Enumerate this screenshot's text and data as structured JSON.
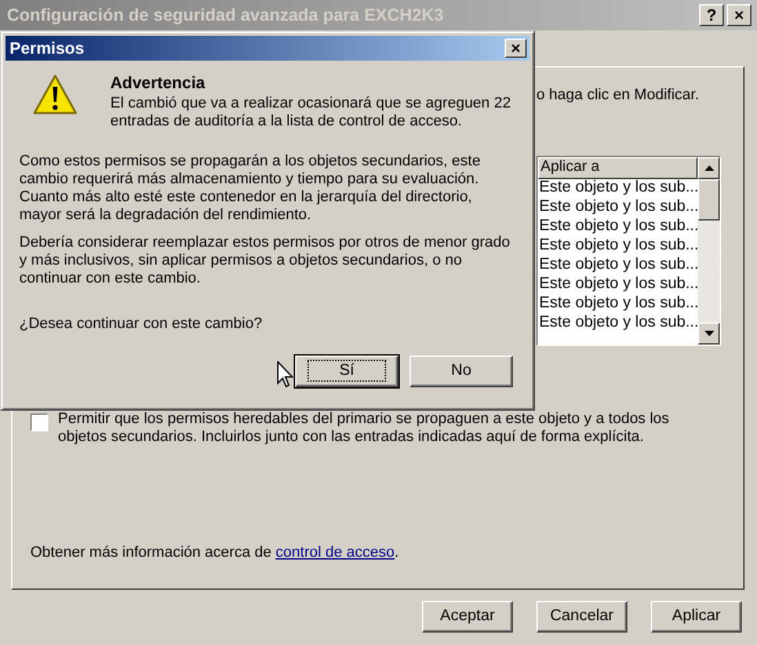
{
  "window": {
    "title": "Configuración de seguridad avanzada para EXCH2K3",
    "title_buttons": [
      "?",
      "×"
    ]
  },
  "instruction": "o haga clic en Modificar.",
  "entries_list": {
    "columns": [
      "Aplicar a"
    ],
    "rows": [
      "Este objeto y los sub...",
      "Este objeto y los sub...",
      "Este objeto y los sub...",
      "Este objeto y los sub...",
      "Este objeto y los sub...",
      "Este objeto y los sub...",
      "Este objeto y los sub...",
      "Este objeto y los sub..."
    ]
  },
  "inherit_checkbox": {
    "label": "Permitir que los permisos heredables del primario se propaguen a este objeto y a todos los objetos secundarios. Incluirlos junto con las entradas indicadas aquí de forma explícita.",
    "checked": false
  },
  "help_text": {
    "before": "Obtener más información acerca de ",
    "link": "control de acceso",
    "after": "."
  },
  "footer_buttons": [
    {
      "label": "Aceptar"
    },
    {
      "label": "Cancelar"
    },
    {
      "label": "Aplicar"
    }
  ],
  "dialog": {
    "title": "Permisos",
    "close": "×",
    "heading": "Advertencia",
    "message": "El cambió que va a realizar ocasionará que se agreguen 22 entradas de auditoría a la lista de control de acceso.",
    "paragraphs": [
      "Como estos permisos se propagarán a los objetos secundarios, este cambio requerirá más almacenamiento y tiempo para su evaluación. Cuanto más alto esté este contenedor en la jerarquía del directorio, mayor será la degradación del rendimiento.",
      "Debería considerar reemplazar estos permisos por otros de menor grado y más inclusivos, sin aplicar permisos a objetos secundarios, o no continuar con este cambio."
    ],
    "question": "¿Desea continuar con este cambio?",
    "buttons": [
      {
        "label": "Sí",
        "default": true
      },
      {
        "label": "No",
        "default": false
      }
    ]
  }
}
